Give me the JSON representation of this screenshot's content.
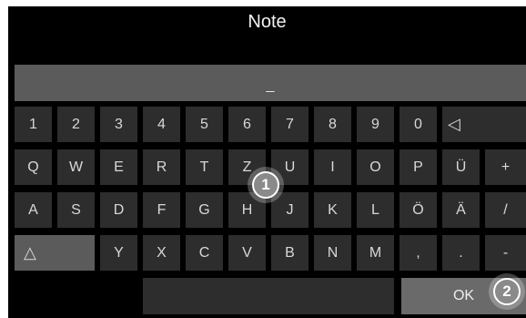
{
  "title": "Note",
  "input": {
    "value": "_"
  },
  "rows": [
    [
      "1",
      "2",
      "3",
      "4",
      "5",
      "6",
      "7",
      "8",
      "9",
      "0"
    ],
    [
      "Q",
      "W",
      "E",
      "R",
      "T",
      "Z",
      "U",
      "I",
      "O",
      "P",
      "Ü",
      "+"
    ],
    [
      "A",
      "S",
      "D",
      "F",
      "G",
      "H",
      "J",
      "K",
      "L",
      "Ö",
      "Ä",
      "/"
    ],
    [
      "Y",
      "X",
      "C",
      "V",
      "B",
      "N",
      "M",
      ",",
      ".",
      "-"
    ]
  ],
  "keys": {
    "backspace": "◁",
    "shift": "△",
    "space": "",
    "ok": "OK"
  },
  "badges": [
    "1",
    "2"
  ],
  "colors": {
    "background": "#000000",
    "key": "#2d2d2d",
    "key_light": "#5b5b5b",
    "ok": "#6a6a6a",
    "text": "#d8d8d8"
  }
}
